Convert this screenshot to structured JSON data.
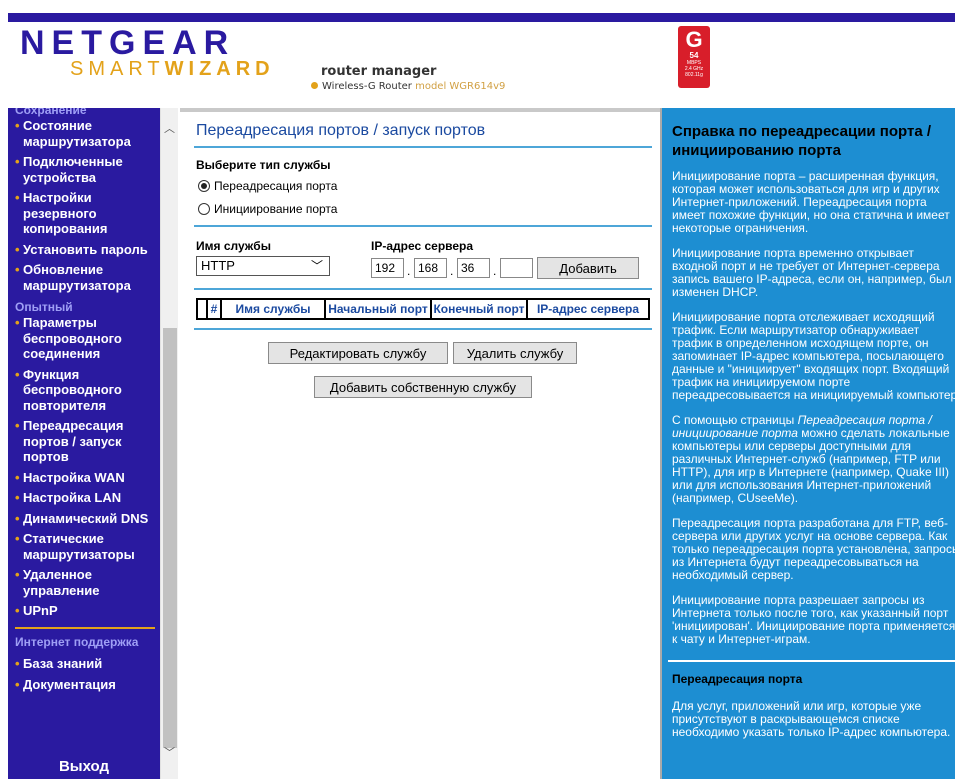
{
  "header": {
    "brand": "NETGEAR",
    "smart": "SMART",
    "wizard": "WIZARD",
    "router_manager": "router manager",
    "product": "Wireless-G Router",
    "model": "model WGR614v9",
    "badge_letter": "G",
    "badge_speed": "54",
    "badge_unit": "MBPS",
    "badge_band": "2.4 GHz",
    "badge_std": "802.11g"
  },
  "sidebar": {
    "group_top": "Сохранение",
    "items_a": [
      "Состояние маршрутизатора",
      "Подключенные устройства",
      "Настройки резервного копирования",
      "Установить пароль",
      "Обновление маршрутизатора"
    ],
    "group_advanced": "Опытный",
    "items_b": [
      "Параметры беспроводного соединения",
      "Функция беспроводного повторителя",
      "Переадресация портов / запуск портов",
      "Настройка WAN",
      "Настройка LAN",
      "Динамический DNS",
      "Статические маршрутизаторы",
      "Удаленное управление",
      "UPnP"
    ],
    "group_support": "Интернет поддержка",
    "items_c": [
      "База знаний",
      "Документация"
    ],
    "logout": "Выход"
  },
  "main": {
    "title": "Переадресация портов / запуск портов",
    "service_type_label": "Выберите тип службы",
    "radio_forwarding": "Переадресация порта",
    "radio_triggering": "Инициирование порта",
    "service_name_label": "Имя службы",
    "service_selected": "HTTP",
    "server_ip_label": "IP-адрес сервера",
    "ip": [
      "192",
      "168",
      "36",
      ""
    ],
    "add_button": "Добавить",
    "table_headers": [
      "#",
      "Имя службы",
      "Начальный порт",
      "Конечный порт",
      "IP-адрес сервера"
    ],
    "edit_button": "Редактировать службу",
    "delete_button": "Удалить службу",
    "add_custom_button": "Добавить собственную службу"
  },
  "help": {
    "title": "Справка по переадресации порта / инициированию порта",
    "p1": "Инициирование порта – расширенная функция, которая может использоваться для игр и других Интернет-приложений. Переадресация порта имеет похожие функции, но она статична и имеет некоторые ограничения.",
    "p2": "Инициирование порта временно открывает входной порт и не требует от Интернет-сервера запись вашего IP-адреса, если он, например, был изменен DHCP.",
    "p3": "Инициирование порта отслеживает исходящий трафик. Если маршрутизатор обнаруживает трафик в определенном исходящем порте, он запоминает IP-адрес компьютера, посылающего данные и \"инициирует\" входящих порт. Входящий трафик на инициируемом порте переадресовывается на инициируемый компьютер.",
    "p4_pre": "С помощью страницы ",
    "p4_em": "Переадресация порта / инициирование порта",
    "p4_post": " можно сделать локальные компьютеры или серверы доступными для различных Интернет-служб (например, FTP или HTTP), для игр в Интернете (например, Quake III) или для использования Интернет-приложений (например, CUseeMe).",
    "p5": "Переадресация порта разработана для FTP, веб-сервера или других услуг на основе сервера. Как только переадресация порта установлена, запросы из Интернета будут переадресовываться на необходимый сервер.",
    "p6": "Инициирование порта разрешает запросы из Интернета только после того, как указанный порт 'инициирован'. Инициирование порта применяется к чату и Интернет-играм.",
    "sub_title": "Переадресация порта",
    "p7": "Для услуг, приложений или игр, которые уже присутствуют в раскрывающемся списке необходимо указать только IP-адрес компьютера."
  },
  "colors": {
    "nav_bg": "#2a1aa0",
    "accent": "#e3a21a",
    "help_bg": "#1d8ed2",
    "title_blue": "#1b4aa0"
  }
}
